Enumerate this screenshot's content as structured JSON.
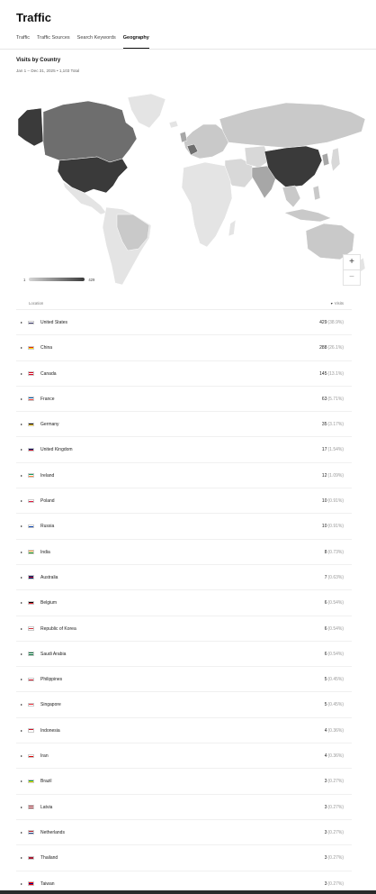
{
  "page": {
    "title": "Traffic",
    "tabs": [
      {
        "label": "Traffic",
        "active": false
      },
      {
        "label": "Traffic Sources",
        "active": false
      },
      {
        "label": "Search Keywords",
        "active": false
      },
      {
        "label": "Geography",
        "active": true
      }
    ]
  },
  "section": {
    "title": "Visits by Country",
    "subtitle": "Jan 1 – Dec 31, 2025 • 1,103 Total"
  },
  "map": {
    "legend_min": "1",
    "legend_max": "429",
    "zoom_in": "+",
    "zoom_out": "−",
    "colors": {
      "top": "#3a3a3a",
      "high": "#6e6e6e",
      "mid": "#a7a7a7",
      "low": "#c9c9c9",
      "none": "#e4e4e4"
    }
  },
  "table": {
    "col_location": "Location",
    "col_visits": "Visits",
    "sort_icon": "▾",
    "rows": [
      {
        "country": "United States",
        "visits": "429",
        "pct": "(38.9%)",
        "flag": [
          "#b22234",
          "#ffffff",
          "#3c3b6e"
        ]
      },
      {
        "country": "China",
        "visits": "288",
        "pct": "(26.1%)",
        "flag": [
          "#de2910",
          "#de2910",
          "#ffde00"
        ]
      },
      {
        "country": "Canada",
        "visits": "145",
        "pct": "(13.1%)",
        "flag": [
          "#d80621",
          "#ffffff",
          "#d80621"
        ]
      },
      {
        "country": "France",
        "visits": "63",
        "pct": "(5.71%)",
        "flag": [
          "#0055a4",
          "#ffffff",
          "#ef4135"
        ]
      },
      {
        "country": "Germany",
        "visits": "35",
        "pct": "(3.17%)",
        "flag": [
          "#000000",
          "#dd0000",
          "#ffce00"
        ]
      },
      {
        "country": "United Kingdom",
        "visits": "17",
        "pct": "(1.54%)",
        "flag": [
          "#012169",
          "#c8102e",
          "#012169"
        ]
      },
      {
        "country": "Ireland",
        "visits": "12",
        "pct": "(1.09%)",
        "flag": [
          "#169b62",
          "#ffffff",
          "#ff883e"
        ]
      },
      {
        "country": "Poland",
        "visits": "10",
        "pct": "(0.91%)",
        "flag": [
          "#ffffff",
          "#ffffff",
          "#dc143c"
        ]
      },
      {
        "country": "Russia",
        "visits": "10",
        "pct": "(0.91%)",
        "flag": [
          "#ffffff",
          "#0039a6",
          "#d52b1e"
        ]
      },
      {
        "country": "India",
        "visits": "8",
        "pct": "(0.73%)",
        "flag": [
          "#ff9933",
          "#ffffff",
          "#138808"
        ]
      },
      {
        "country": "Australia",
        "visits": "7",
        "pct": "(0.63%)",
        "flag": [
          "#012169",
          "#c8102e",
          "#012169"
        ]
      },
      {
        "country": "Belgium",
        "visits": "6",
        "pct": "(0.54%)",
        "flag": [
          "#000000",
          "#fae042",
          "#ed2939"
        ]
      },
      {
        "country": "Republic of Korea",
        "visits": "6",
        "pct": "(0.54%)",
        "flag": [
          "#ffffff",
          "#cd2e3a",
          "#ffffff"
        ]
      },
      {
        "country": "Saudi Arabia",
        "visits": "6",
        "pct": "(0.54%)",
        "flag": [
          "#006c35",
          "#ffffff",
          "#006c35"
        ]
      },
      {
        "country": "Philippines",
        "visits": "5",
        "pct": "(0.45%)",
        "flag": [
          "#0038a8",
          "#ffffff",
          "#ce1126"
        ]
      },
      {
        "country": "Singapore",
        "visits": "5",
        "pct": "(0.45%)",
        "flag": [
          "#ef3340",
          "#ffffff",
          "#ffffff"
        ]
      },
      {
        "country": "Indonesia",
        "visits": "4",
        "pct": "(0.36%)",
        "flag": [
          "#ce1126",
          "#ffffff",
          "#ffffff"
        ]
      },
      {
        "country": "Iran",
        "visits": "4",
        "pct": "(0.36%)",
        "flag": [
          "#239f40",
          "#ffffff",
          "#da0000"
        ]
      },
      {
        "country": "Brazil",
        "visits": "3",
        "pct": "(0.27%)",
        "flag": [
          "#009c3b",
          "#ffdf00",
          "#009c3b"
        ]
      },
      {
        "country": "Latvia",
        "visits": "3",
        "pct": "(0.27%)",
        "flag": [
          "#9e3039",
          "#ffffff",
          "#9e3039"
        ]
      },
      {
        "country": "Netherlands",
        "visits": "3",
        "pct": "(0.27%)",
        "flag": [
          "#ae1c28",
          "#ffffff",
          "#21468b"
        ]
      },
      {
        "country": "Thailand",
        "visits": "3",
        "pct": "(0.27%)",
        "flag": [
          "#a51931",
          "#2d2a4a",
          "#a51931"
        ]
      },
      {
        "country": "Taiwan",
        "visits": "3",
        "pct": "(0.27%)",
        "flag": [
          "#fe0000",
          "#000095",
          "#fe0000"
        ]
      }
    ]
  }
}
